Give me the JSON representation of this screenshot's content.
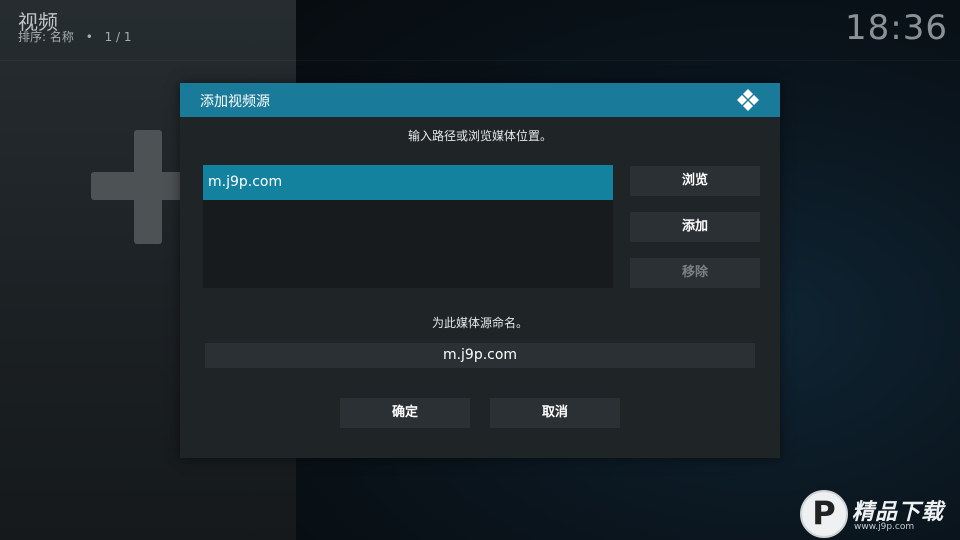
{
  "window": {
    "title": "视频",
    "sort_label": "排序: 名称",
    "sort_dot": "•",
    "page_info": "1 / 1",
    "clock": "18:36"
  },
  "background": {
    "add_icon": "plus-icon"
  },
  "dialog": {
    "title": "添加视频源",
    "logo_icon": "kodi-icon",
    "instruction": "输入路径或浏览媒体位置。",
    "paths": [
      "m.j9p.com"
    ],
    "buttons": {
      "browse": "浏览",
      "add": "添加",
      "remove": "移除"
    },
    "name_label": "为此媒体源命名。",
    "name_value": "m.j9p.com",
    "ok": "确定",
    "cancel": "取消"
  },
  "watermark": {
    "logo_letter": "P",
    "text": "精品下载",
    "url": "www.j9p.com"
  },
  "colors": {
    "header": "#1a7a99",
    "selected_item": "#12829f",
    "dialog_bg": "#1f2426",
    "button_bg": "#2a3033"
  }
}
